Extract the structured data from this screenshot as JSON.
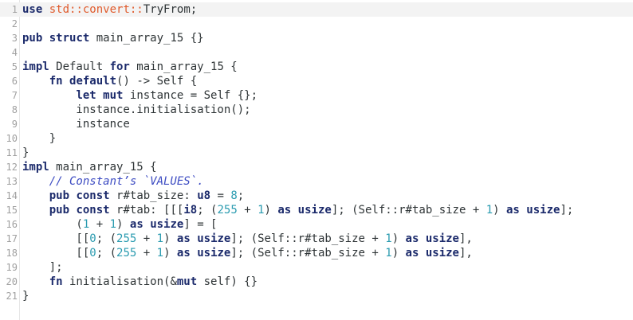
{
  "editor": {
    "lines": [
      {
        "n": "1",
        "tokens": [
          [
            "kw",
            "use"
          ],
          [
            "op",
            " "
          ],
          [
            "path",
            "std::convert::"
          ],
          [
            "op",
            "TryFrom;"
          ]
        ]
      },
      {
        "n": "2",
        "tokens": []
      },
      {
        "n": "3",
        "tokens": [
          [
            "kw",
            "pub"
          ],
          [
            "op",
            " "
          ],
          [
            "kw",
            "struct"
          ],
          [
            "op",
            " main_array_15 {}"
          ]
        ]
      },
      {
        "n": "4",
        "tokens": []
      },
      {
        "n": "5",
        "tokens": [
          [
            "kw",
            "impl"
          ],
          [
            "op",
            " Default "
          ],
          [
            "kw",
            "for"
          ],
          [
            "op",
            " main_array_15 {"
          ]
        ]
      },
      {
        "n": "6",
        "tokens": [
          [
            "op",
            "    "
          ],
          [
            "kw",
            "fn"
          ],
          [
            "op",
            " "
          ],
          [
            "kw",
            "default"
          ],
          [
            "op",
            "() -> Self {"
          ]
        ]
      },
      {
        "n": "7",
        "tokens": [
          [
            "op",
            "        "
          ],
          [
            "kw",
            "let"
          ],
          [
            "op",
            " "
          ],
          [
            "kw",
            "mut"
          ],
          [
            "op",
            " instance = Self {};"
          ]
        ]
      },
      {
        "n": "8",
        "tokens": [
          [
            "op",
            "        instance.initialisation();"
          ]
        ]
      },
      {
        "n": "9",
        "tokens": [
          [
            "op",
            "        instance"
          ]
        ]
      },
      {
        "n": "10",
        "tokens": [
          [
            "op",
            "    }"
          ]
        ]
      },
      {
        "n": "11",
        "tokens": [
          [
            "op",
            "}"
          ]
        ]
      },
      {
        "n": "12",
        "tokens": [
          [
            "kw",
            "impl"
          ],
          [
            "op",
            " main_array_15 {"
          ]
        ]
      },
      {
        "n": "13",
        "tokens": [
          [
            "op",
            "    "
          ],
          [
            "cm",
            "// Constant’s `VALUES`."
          ]
        ]
      },
      {
        "n": "14",
        "tokens": [
          [
            "op",
            "    "
          ],
          [
            "kw",
            "pub"
          ],
          [
            "op",
            " "
          ],
          [
            "kw",
            "const"
          ],
          [
            "op",
            " r#tab_size: "
          ],
          [
            "ty",
            "u8"
          ],
          [
            "op",
            " = "
          ],
          [
            "num",
            "8"
          ],
          [
            "op",
            ";"
          ]
        ]
      },
      {
        "n": "15",
        "tokens": [
          [
            "op",
            "    "
          ],
          [
            "kw",
            "pub"
          ],
          [
            "op",
            " "
          ],
          [
            "kw",
            "const"
          ],
          [
            "op",
            " r#tab: [[["
          ],
          [
            "ty",
            "i8"
          ],
          [
            "op",
            "; ("
          ],
          [
            "num",
            "255"
          ],
          [
            "op",
            " + "
          ],
          [
            "num",
            "1"
          ],
          [
            "op",
            ") "
          ],
          [
            "kw",
            "as"
          ],
          [
            "op",
            " "
          ],
          [
            "ty",
            "usize"
          ],
          [
            "op",
            "]; (Self::r#tab_size + "
          ],
          [
            "num",
            "1"
          ],
          [
            "op",
            ") "
          ],
          [
            "kw",
            "as"
          ],
          [
            "op",
            " "
          ],
          [
            "ty",
            "usize"
          ],
          [
            "op",
            "];"
          ]
        ]
      },
      {
        "n": "16",
        "tokens": [
          [
            "op",
            "        ("
          ],
          [
            "num",
            "1"
          ],
          [
            "op",
            " + "
          ],
          [
            "num",
            "1"
          ],
          [
            "op",
            ") "
          ],
          [
            "kw",
            "as"
          ],
          [
            "op",
            " "
          ],
          [
            "ty",
            "usize"
          ],
          [
            "op",
            "] = ["
          ]
        ]
      },
      {
        "n": "17",
        "tokens": [
          [
            "op",
            "        [["
          ],
          [
            "num",
            "0"
          ],
          [
            "op",
            "; ("
          ],
          [
            "num",
            "255"
          ],
          [
            "op",
            " + "
          ],
          [
            "num",
            "1"
          ],
          [
            "op",
            ") "
          ],
          [
            "kw",
            "as"
          ],
          [
            "op",
            " "
          ],
          [
            "ty",
            "usize"
          ],
          [
            "op",
            "]; (Self::r#tab_size + "
          ],
          [
            "num",
            "1"
          ],
          [
            "op",
            ") "
          ],
          [
            "kw",
            "as"
          ],
          [
            "op",
            " "
          ],
          [
            "ty",
            "usize"
          ],
          [
            "op",
            "],"
          ]
        ]
      },
      {
        "n": "18",
        "tokens": [
          [
            "op",
            "        [["
          ],
          [
            "num",
            "0"
          ],
          [
            "op",
            "; ("
          ],
          [
            "num",
            "255"
          ],
          [
            "op",
            " + "
          ],
          [
            "num",
            "1"
          ],
          [
            "op",
            ") "
          ],
          [
            "kw",
            "as"
          ],
          [
            "op",
            " "
          ],
          [
            "ty",
            "usize"
          ],
          [
            "op",
            "]; (Self::r#tab_size + "
          ],
          [
            "num",
            "1"
          ],
          [
            "op",
            ") "
          ],
          [
            "kw",
            "as"
          ],
          [
            "op",
            " "
          ],
          [
            "ty",
            "usize"
          ],
          [
            "op",
            "],"
          ]
        ]
      },
      {
        "n": "19",
        "tokens": [
          [
            "op",
            "    ];"
          ]
        ]
      },
      {
        "n": "20",
        "tokens": [
          [
            "op",
            "    "
          ],
          [
            "kw",
            "fn"
          ],
          [
            "op",
            " initialisation(&"
          ],
          [
            "kw",
            "mut"
          ],
          [
            "op",
            " self) {}"
          ]
        ]
      },
      {
        "n": "21",
        "tokens": [
          [
            "op",
            "}"
          ]
        ]
      }
    ]
  }
}
